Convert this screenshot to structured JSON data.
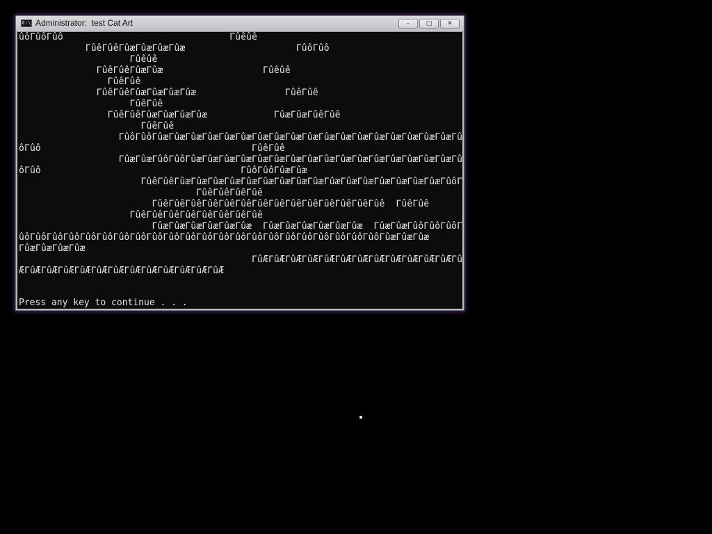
{
  "window": {
    "title": "Administrator:  test Cat Art",
    "icon": "cmd-icon",
    "icon_label": "C:\\",
    "minimize_glyph": "–",
    "maximize_glyph": "□",
    "close_glyph": "✕"
  },
  "console": {
    "lines": [
      "ûôΓûôΓûô                              Γûêûê",
      "            ΓûêΓûêΓûæΓûæΓûæΓûæ                    ΓûôΓûô",
      "                    Γûêûê",
      "              ΓûêΓûêΓûæΓûæ                  Γûêûê",
      "                ΓûêΓûê",
      "              ΓûêΓûêΓûæΓûæΓûæΓûæ                ΓûêΓûê",
      "                    ΓûêΓûê",
      "                ΓûêΓûêΓûæΓûæΓûæΓûæ            ΓûæΓûæΓûêΓûê",
      "                      ΓûêΓûê",
      "                  ΓûôΓûôΓûæΓûæΓûæΓûæΓûæΓûæΓûæΓûæΓûæΓûæΓûæΓûæΓûæΓûæΓûæΓûæΓûæΓûæΓûæΓûæΓû",
      "ôΓûô                                      ΓûêΓûê",
      "                  ΓûæΓûæΓûôΓûôΓûæΓûæΓûæΓûæΓûæΓûæΓûæΓûæΓûæΓûæΓûæΓûæΓûæΓûæΓûæΓûæΓûæΓûæΓû",
      "ôΓûô                                    ΓûôΓûôΓûæΓûæ",
      "                      ΓûêΓûêΓûæΓûæΓûæΓûæΓûæΓûæΓûæΓûæΓûæΓûæΓûæΓûæΓûæΓûæΓûæΓûæΓûôΓûô",
      "                                ΓûêΓûêΓûêΓûê",
      "                        ΓûêΓûêΓûêΓûêΓûêΓûêΓûêΓûêΓûêΓûêΓûêΓûêΓûêΓûê  ΓûêΓûê",
      "                    ΓûêΓûêΓûêΓûêΓûêΓûêΓûêΓûê",
      "                        ΓûæΓûæΓûæΓûæΓûæΓûæ  ΓûæΓûæΓûæΓûæΓûæΓûæ  ΓûæΓûæΓûôΓûôΓûôΓ",
      "ûôΓûôΓûôΓûôΓûôΓûôΓûôΓûôΓûôΓûôΓûôΓûôΓûôΓûôΓûôΓûôΓûôΓûôΓûôΓûôΓûôΓûôΓûæΓûæΓûæ",
      "ΓûæΓûæΓûæΓûæ",
      "                                          ΓûÆΓûÆΓûÆΓûÆΓûÆΓûÆΓûÆΓûÆΓûÆΓûÆΓûÆΓûÆΓûÆΓû",
      "ÆΓûÆΓûÆΓûÆΓûÆΓûÆΓûÆΓûÆΓûÆΓûÆΓûÆΓûÆΓûÆ",
      "",
      ""
    ],
    "prompt": "Press any key to continue . . ."
  }
}
